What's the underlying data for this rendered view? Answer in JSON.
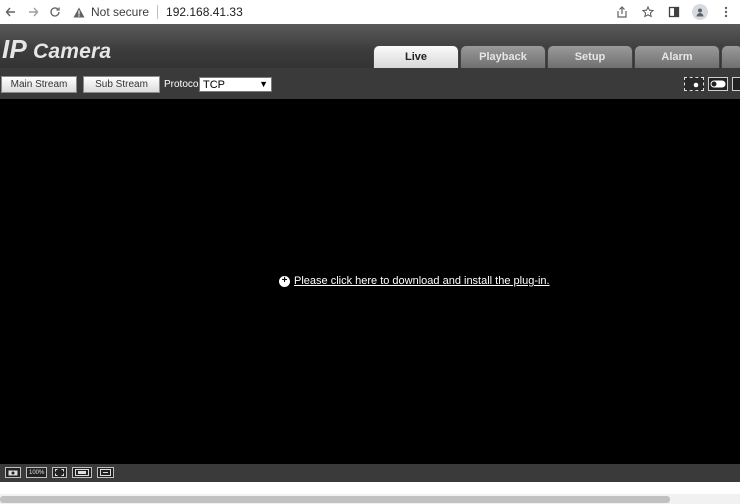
{
  "browser": {
    "security_label": "Not secure",
    "url": "192.168.41.33",
    "icons": [
      "back-icon",
      "forward-icon",
      "reload-icon",
      "warning-icon",
      "share-icon",
      "star-icon",
      "sidebar-icon",
      "profile-icon",
      "menu-icon"
    ]
  },
  "app": {
    "brand_ip": "IP",
    "brand_rest": " Camera",
    "tabs": [
      {
        "label": "Live",
        "active": true
      },
      {
        "label": "Playback",
        "active": false
      },
      {
        "label": "Setup",
        "active": false
      },
      {
        "label": "Alarm",
        "active": false
      }
    ]
  },
  "toolbar": {
    "main_stream": "Main Stream",
    "sub_stream": "Sub Stream",
    "protocol_label": "Protocol",
    "protocol_value": "TCP"
  },
  "video": {
    "plugin_message": "Please click here to download and install the plug-in."
  },
  "bottom": {
    "zoom_label": "100%",
    "icons": [
      "camera-icon",
      "zoom-100-icon",
      "fullscreen-icon",
      "aspect-ratio-icon",
      "stretch-icon"
    ]
  }
}
